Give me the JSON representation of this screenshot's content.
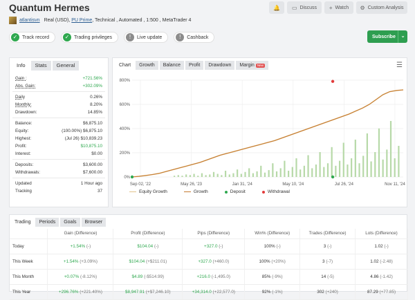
{
  "header": {
    "title": "Quantum Hermes",
    "author": "atlantisvn",
    "meta": "Real (USD),",
    "broker": "PU Prime",
    "details": ", Technical , Automated , 1:500 , MetaTrader 4",
    "buttons": {
      "notify": "",
      "discuss": "Discuss",
      "watch": "Watch",
      "analysis": "Custom Analysis"
    }
  },
  "badges": [
    {
      "label": "Track record",
      "status": "green"
    },
    {
      "label": "Trading privileges",
      "status": "green"
    },
    {
      "label": "Live update",
      "status": "grey"
    },
    {
      "label": "Cashback",
      "status": "grey"
    }
  ],
  "subscribe": {
    "label": "Subscribe"
  },
  "stats": {
    "tabs": [
      "Info",
      "Stats",
      "General"
    ],
    "rows1": [
      {
        "k": "Gain :",
        "v": "+721.56%",
        "green": true,
        "ul": true
      },
      {
        "k": "Abs. Gain:",
        "v": "+302.09%",
        "green": true,
        "ul": true
      }
    ],
    "rows2": [
      {
        "k": "Daily",
        "v": "0.26%",
        "ul": true
      },
      {
        "k": "Monthly:",
        "v": "8.20%",
        "ul": true
      },
      {
        "k": "Drawdown:",
        "v": "14.85%"
      }
    ],
    "rows3": [
      {
        "k": "Balance:",
        "v": "$6,875.10"
      },
      {
        "k": "Equity:",
        "v": "(100.00%) $6,875.10"
      },
      {
        "k": "Highest:",
        "v": "(Jul 26) $10,839.23"
      },
      {
        "k": "Profit:",
        "v": "$10,875.10",
        "green": true
      },
      {
        "k": "Interest:",
        "v": "$0.00"
      }
    ],
    "rows4": [
      {
        "k": "Deposits:",
        "v": "$3,600.00"
      },
      {
        "k": "Withdrawals:",
        "v": "$7,600.00"
      }
    ],
    "rows5": [
      {
        "k": "Updated",
        "v": "1 Hour ago"
      },
      {
        "k": "Tracking",
        "v": "37"
      }
    ]
  },
  "chart_tabs": [
    "Chart",
    "Growth",
    "Balance",
    "Profit",
    "Drawdown",
    "Margin"
  ],
  "chart_new_badge": "New",
  "chart_data": {
    "type": "line",
    "x_ticks": [
      "Sep 02, '22",
      "May 26, '23",
      "Jan 31, '24",
      "May 10, '24",
      "Jul 26, '24",
      "Nov 11, '24"
    ],
    "y_ticks": [
      "0%",
      "200%",
      "400%",
      "600%",
      "800%"
    ],
    "ylim": [
      0,
      800
    ],
    "series": [
      {
        "name": "Equity Growth",
        "color": "#e2c48a",
        "values": [
          0,
          5,
          12,
          20,
          30,
          45,
          60,
          75,
          90,
          105,
          120,
          140,
          160,
          180,
          195,
          210,
          225,
          240,
          255,
          270,
          285,
          300,
          320,
          340,
          360,
          380,
          400,
          420,
          440,
          460,
          480,
          500,
          520,
          545,
          570,
          600,
          640,
          680,
          705,
          715,
          720
        ]
      },
      {
        "name": "Growth",
        "color": "#c5782f",
        "values": [
          0,
          5,
          12,
          20,
          30,
          45,
          60,
          75,
          90,
          105,
          120,
          140,
          160,
          180,
          195,
          210,
          225,
          240,
          255,
          270,
          285,
          300,
          320,
          340,
          360,
          380,
          400,
          420,
          440,
          460,
          480,
          500,
          520,
          545,
          570,
          600,
          640,
          680,
          705,
          715,
          720
        ]
      }
    ],
    "deposits": [
      {
        "x": 0,
        "y": 0
      },
      {
        "x": 0.74,
        "y": 0
      }
    ],
    "withdrawals": [
      {
        "x": 0.74,
        "y": 790
      }
    ],
    "bars": [
      2,
      3,
      2,
      4,
      3,
      5,
      2,
      6,
      3,
      4,
      8,
      5,
      3,
      10,
      4,
      6,
      12,
      5,
      8,
      14,
      6,
      9,
      18,
      7,
      11,
      22,
      9,
      14,
      26,
      10,
      16,
      30,
      12,
      18,
      35,
      14,
      20,
      40,
      16,
      22,
      48,
      18,
      26,
      55,
      20,
      30,
      60,
      22,
      34,
      70,
      25,
      40,
      78,
      28,
      44,
      90,
      30,
      50
    ]
  },
  "legend": {
    "equity": "Equity Growth",
    "growth": "Growth",
    "deposit": "Deposit",
    "withdrawal": "Withdrawal"
  },
  "trading": {
    "tabs": [
      "Trading",
      "Periods",
      "Goals",
      "Browser"
    ],
    "columns": [
      "",
      "Gain (Difference)",
      "Profit (Difference)",
      "Pips (Difference)",
      "Win% (Difference)",
      "Trades (Difference)",
      "Lots (Difference)"
    ],
    "rows": [
      {
        "period": "Today",
        "gain": "+1.54%",
        "gain_d": "(-)",
        "profit": "$104.04",
        "profit_d": "(-)",
        "pips": "+327.0",
        "pips_d": "(-)",
        "win": "100%",
        "win_d": "(-)",
        "trades": "3",
        "trades_d": "(-)",
        "lots": "1.02",
        "lots_d": "(-)"
      },
      {
        "period": "This Week",
        "gain": "+1.54%",
        "gain_d": "(+3.09%)",
        "profit": "$104.04",
        "profit_d": "(+$211.01)",
        "pips": "+327.0",
        "pips_d": "(+460.0)",
        "win": "100%",
        "win_d": "(+20%)",
        "trades": "3",
        "trades_d": "(-7)",
        "lots": "1.02",
        "lots_d": "(-2.48)"
      },
      {
        "period": "This Month",
        "gain": "+0.07%",
        "gain_d": "(-8.12%)",
        "profit": "$4.89",
        "profit_d": "(-$514.99)",
        "pips": "+216.0",
        "pips_d": "(-1,495.0)",
        "win": "85%",
        "win_d": "(-9%)",
        "trades": "14",
        "trades_d": "(-5)",
        "lots": "4.86",
        "lots_d": "(-1.42)"
      },
      {
        "period": "This Year",
        "gain": "+296.76%",
        "gain_d": "(+221.40%)",
        "profit": "$8,947.91",
        "profit_d": "(+$7,246.10)",
        "pips": "+34,314.0",
        "pips_d": "(+22,577.0)",
        "win": "92%",
        "win_d": "(-1%)",
        "trades": "302",
        "trades_d": "(+240)",
        "lots": "87.29",
        "lots_d": "(+77.85)"
      }
    ]
  }
}
